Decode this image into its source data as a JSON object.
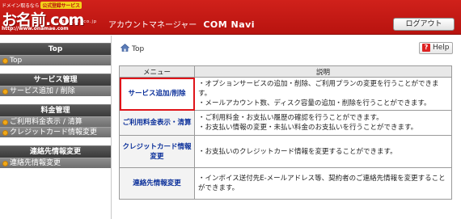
{
  "header": {
    "tagline": "ドメイン取るなら",
    "badge": "公式登録サービス",
    "logo": "お名前.com",
    "logo_sub": ".com .jp .co.jp",
    "url": "http://www.onamae.com",
    "title": "アカウントマネージャー",
    "title_brand": "COM Navi",
    "logout_label": "ログアウト"
  },
  "sidebar": {
    "sections": [
      {
        "heading": "Top",
        "items": [
          "Top"
        ]
      },
      {
        "heading": "サービス管理",
        "items": [
          "サービス追加 / 削除"
        ]
      },
      {
        "heading": "料金管理",
        "items": [
          "ご利用料金表示 / 清算",
          "クレジットカード情報変更"
        ]
      },
      {
        "heading": "連絡先情報変更",
        "items": [
          "連絡先情報変更"
        ]
      }
    ]
  },
  "main": {
    "breadcrumb": "Top",
    "help_label": "Help",
    "table": {
      "headers": [
        "メニュー",
        "説明"
      ],
      "rows": [
        {
          "menu": "サービス追加/削除",
          "desc": [
            "・オプションサービスの追加・削除、ご利用プランの変更を行うことができます。",
            "・メールアカウント数、ディスク容量の追加・削除を行うことができます。"
          ]
        },
        {
          "menu": "ご利用料金表示・清算",
          "desc": [
            "・ご利用料金・お支払い履歴の確認を行うことができます。",
            "・お支払い情報の変更・未払い料金のお支払いを行うことができます。"
          ]
        },
        {
          "menu": "クレジットカード情報変更",
          "desc": [
            "・お支払いのクレジットカード情報を変更することができます。"
          ]
        },
        {
          "menu": "連絡先情報変更",
          "desc": [
            "・インボイス送付先E-メールアドレス等、契約者のご連絡先情報を変更することができます。"
          ]
        }
      ]
    }
  },
  "colors": {
    "brand_red": "#c41a15",
    "link_blue": "#0a2f9a",
    "highlight": "#e0141a",
    "bullet": "#f0a91a"
  }
}
